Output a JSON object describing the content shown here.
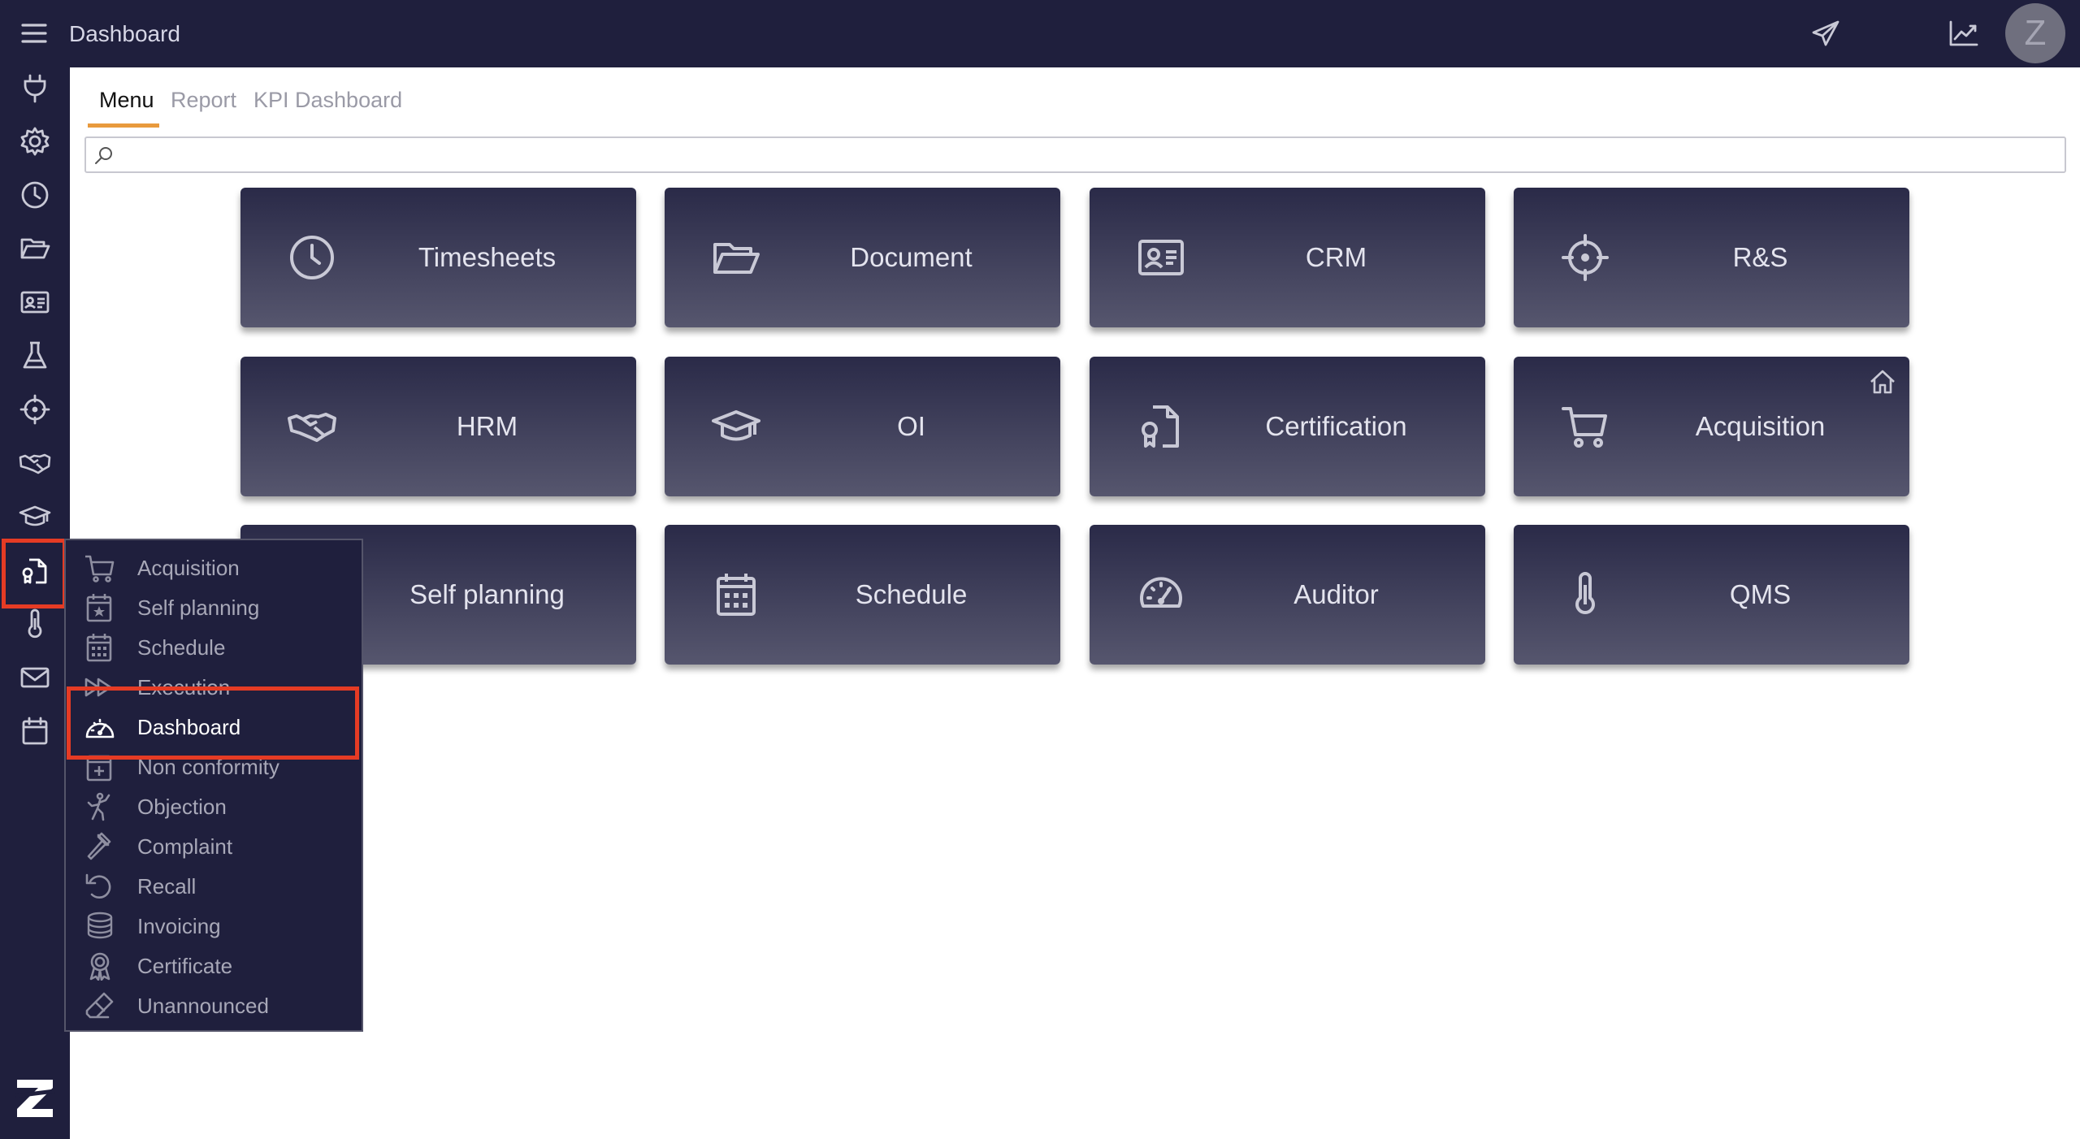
{
  "header": {
    "title": "Dashboard",
    "avatar_initial": "Z"
  },
  "tabs": [
    {
      "label": "Menu"
    },
    {
      "label": "Report"
    },
    {
      "label": "KPI Dashboard"
    }
  ],
  "search": {
    "placeholder": "",
    "value": ""
  },
  "tiles": [
    {
      "label": "Timesheets",
      "icon": "clock-icon"
    },
    {
      "label": "Document",
      "icon": "folder-open-icon"
    },
    {
      "label": "CRM",
      "icon": "id-card-icon"
    },
    {
      "label": "R&S",
      "icon": "crosshair-icon"
    },
    {
      "label": "HRM",
      "icon": "handshake-icon"
    },
    {
      "label": "OI",
      "icon": "graduation-cap-icon"
    },
    {
      "label": "Certification",
      "icon": "file-certificate-icon"
    },
    {
      "label": "Acquisition",
      "icon": "cart-icon"
    },
    {
      "label": "Self planning",
      "icon": "calendar-star-icon"
    },
    {
      "label": "Schedule",
      "icon": "calendar-grid-icon"
    },
    {
      "label": "Auditor",
      "icon": "gauge-icon"
    },
    {
      "label": "QMS",
      "icon": "thermometer-icon"
    }
  ],
  "dropdown": {
    "items": [
      {
        "label": "Acquisition",
        "icon": "cart-icon"
      },
      {
        "label": "Self planning",
        "icon": "calendar-star-icon"
      },
      {
        "label": "Schedule",
        "icon": "calendar-grid-icon"
      },
      {
        "label": "Execution",
        "icon": "fast-forward-icon"
      },
      {
        "label": "Dashboard",
        "icon": "gauge-icon"
      },
      {
        "label": "Non conformity",
        "icon": "calendar-plus-icon"
      },
      {
        "label": "Objection",
        "icon": "objection-icon"
      },
      {
        "label": "Complaint",
        "icon": "gavel-icon"
      },
      {
        "label": "Recall",
        "icon": "undo-icon"
      },
      {
        "label": "Invoicing",
        "icon": "coins-icon"
      },
      {
        "label": "Certificate",
        "icon": "award-icon"
      },
      {
        "label": "Unannounced",
        "icon": "eraser-icon"
      }
    ],
    "highlighted": "Dashboard"
  },
  "sidebar": {
    "icons": [
      "plug-icon",
      "gear-icon",
      "clock-icon",
      "folder-open-icon",
      "id-card-icon",
      "flask-icon",
      "crosshair-icon",
      "handshake-icon",
      "graduation-cap-icon",
      "file-certificate-icon",
      "thermometer-icon",
      "mail-icon",
      "calendar-icon"
    ],
    "active": "file-certificate-icon"
  },
  "colors": {
    "bar": "#1f1f3d",
    "accent": "#e89a3d",
    "highlight": "#e53b24"
  }
}
